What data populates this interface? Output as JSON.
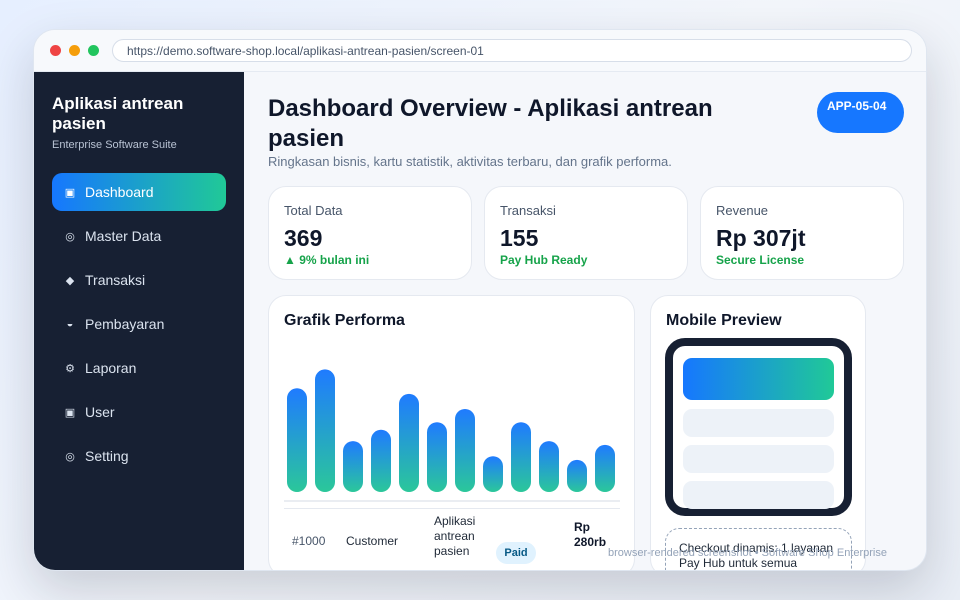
{
  "browser": {
    "url": "https://demo.software-shop.local/aplikasi-antrean-pasien/screen-01"
  },
  "sidebar": {
    "brand": "Aplikasi antrean pasien",
    "subtitle": "Enterprise Software Suite",
    "items": [
      {
        "icon": "▣",
        "label": "Dashboard",
        "active": true
      },
      {
        "icon": "◎",
        "label": "Master Data"
      },
      {
        "icon": "◆",
        "label": "Transaksi"
      },
      {
        "icon": "◒",
        "label": "Pembayaran"
      },
      {
        "icon": "⚙",
        "label": "Laporan"
      },
      {
        "icon": "▣",
        "label": "User"
      },
      {
        "icon": "◎",
        "label": "Setting"
      }
    ]
  },
  "header": {
    "title": "Dashboard Overview - Aplikasi antrean pasien",
    "badge": "APP-05-04",
    "subtitle": "Ringkasan bisnis, kartu statistik, aktivitas terbaru, dan grafik performa."
  },
  "stats": [
    {
      "label": "Total Data",
      "value": "369",
      "note": "▲ 9% bulan ini"
    },
    {
      "label": "Transaksi",
      "value": "155",
      "note": "Pay Hub Ready"
    },
    {
      "label": "Revenue",
      "value": "Rp 307jt",
      "note": "Secure License"
    }
  ],
  "chart_panel": {
    "title": "Grafik Performa"
  },
  "chart_data": {
    "type": "bar",
    "values": [
      55,
      65,
      27,
      33,
      52,
      37,
      44,
      19,
      37,
      27,
      17,
      25
    ],
    "ylim": [
      0,
      70
    ],
    "grid": false,
    "colors": {
      "top": "#1f7bff",
      "bottom": "#2bc79a"
    }
  },
  "recent": {
    "id": "#1000",
    "customer": "Customer",
    "product": "Aplikasi antrean pasien",
    "status": "Paid",
    "amount": "Rp 280rb"
  },
  "mobile_panel": {
    "title": "Mobile Preview",
    "checkout_text": "Checkout dinamis: 1 layanan Pay Hub untuk semua"
  },
  "footer": "browser-rendered screenshot • Software Shop Enterprise"
}
